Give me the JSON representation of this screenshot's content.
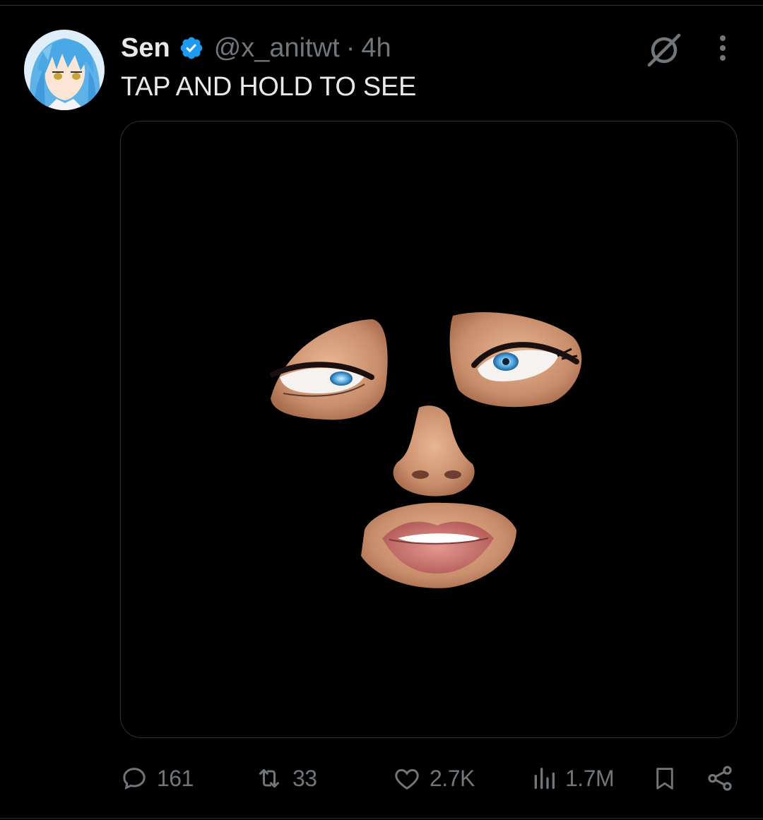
{
  "tweet": {
    "display_name": "Sen",
    "handle": "@x_anitwt",
    "separator": "·",
    "time": "4h",
    "text": "TAP AND HOLD TO SEE"
  },
  "icons": {
    "verified": "verified-badge-icon",
    "grok": "grok-icon",
    "more": "more-vertical-icon",
    "reply": "reply-icon",
    "retweet": "retweet-icon",
    "like": "like-icon",
    "views": "views-icon",
    "bookmark": "bookmark-icon",
    "share": "share-icon"
  },
  "actions": {
    "replies": "161",
    "reposts": "33",
    "likes": "2.7K",
    "views": "1.7M"
  },
  "colors": {
    "background": "#000000",
    "text": "#e7e9ea",
    "muted": "#71767b",
    "verified": "#1d9bf0",
    "divider": "#2f3336"
  }
}
